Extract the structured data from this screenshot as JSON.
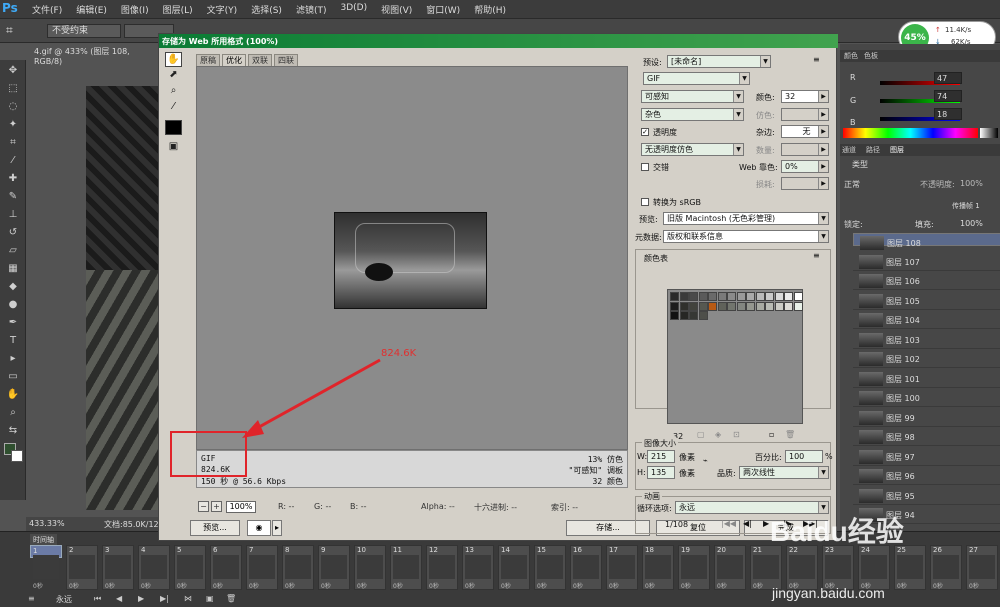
{
  "app": {
    "logo": "Ps",
    "menus": [
      "文件(F)",
      "编辑(E)",
      "图像(I)",
      "图层(L)",
      "文字(Y)",
      "选择(S)",
      "滤镜(T)",
      "3D(D)",
      "视图(V)",
      "窗口(W)",
      "帮助(H)"
    ],
    "options": {
      "preset": "不受约束"
    }
  },
  "network": {
    "percent": "45%",
    "up": "11.4K/s",
    "down": "62K/s"
  },
  "document": {
    "tab": "4.gif @ 433% (图层 108, RGB/8)",
    "zoom": "433.33%",
    "info": "文档:85.0K/12"
  },
  "timeline": {
    "tab": "时间轴",
    "loop": "永远",
    "frames": [
      "1",
      "2",
      "3",
      "4",
      "5",
      "6",
      "7",
      "8",
      "9",
      "10",
      "11",
      "12",
      "13",
      "14",
      "15",
      "16",
      "17",
      "18",
      "19",
      "20",
      "21",
      "22",
      "23",
      "24",
      "25",
      "26",
      "27"
    ],
    "frame_delay": "0秒"
  },
  "panels": {
    "color_tabs": [
      "颜色",
      "色板"
    ],
    "rgb": [
      {
        "ch": "R",
        "val": "47"
      },
      {
        "ch": "G",
        "val": "74"
      },
      {
        "ch": "B",
        "val": "18"
      }
    ],
    "layer_tabs": [
      "通道",
      "路径",
      "图层"
    ],
    "layer_filter": "类型",
    "blend_mode": "正常",
    "opacity_label": "不透明度:",
    "opacity": "100%",
    "lock_label": "锁定:",
    "fill_label": "填充:",
    "fill": "100%",
    "propagate": "传播帧 1",
    "layers": [
      "图层 108",
      "图层 107",
      "图层 106",
      "图层 105",
      "图层 104",
      "图层 103",
      "图层 102",
      "图层 101",
      "图层 100",
      "图层 99",
      "图层 98",
      "图层 97",
      "图层 96",
      "图层 95",
      "图层 94"
    ]
  },
  "dialog": {
    "title": "存储为 Web 所用格式 (100%)",
    "view_tabs": [
      "原稿",
      "优化",
      "双联",
      "四联"
    ],
    "info": {
      "format": "GIF",
      "size": "824.6K",
      "time": "150 秒 @ 56.6 Kbps",
      "dither": "13% 仿色",
      "palette": "\"可感知\" 调板",
      "colors": "32 颜色"
    },
    "annotation": "824.6K",
    "zoom": "100%",
    "readouts": {
      "r": "R: --",
      "g": "G: --",
      "b": "B: --",
      "alpha": "Alpha: --",
      "hex": "十六进制: --",
      "index": "索引: --"
    },
    "buttons": {
      "preview": "预览...",
      "save": "存储...",
      "reset": "复位",
      "done": "完成"
    },
    "settings": {
      "preset_label": "预设:",
      "preset": "[未命名]",
      "format": "GIF",
      "reduction": "可感知",
      "colors_label": "颜色:",
      "colors": "32",
      "dither_algo": "杂色",
      "dither_label": "仿色:",
      "transparency": "透明度",
      "matte_label": "杂边:",
      "matte": "无",
      "trans_dither": "无透明度仿色",
      "amount_label": "数量:",
      "interlaced": "交错",
      "websnap_label": "Web 靠色:",
      "websnap": "0%",
      "lossy_label": "损耗:",
      "srgb": "转换为 sRGB",
      "preview_label": "预览:",
      "preview_val": "旧版 Macintosh (无色彩管理)",
      "metadata_label": "元数据:",
      "metadata": "版权和联系信息",
      "colortable_label": "颜色表",
      "colortable_count": "32",
      "imagesize_label": "图像大小",
      "w_label": "W:",
      "w": "215",
      "h_label": "H:",
      "h": "135",
      "px": "像素",
      "percent_label": "百分比:",
      "percent": "100",
      "pct": "%",
      "quality_label": "品质:",
      "quality": "两次线性",
      "animation_label": "动画",
      "loop_label": "循环选项:",
      "loop": "永远",
      "frame_counter": "1/108"
    },
    "palette_colors": [
      "#2a2a2a",
      "#3a3a3a",
      "#4a4a4a",
      "#5a5a5a",
      "#6a6a6a",
      "#7a7a7a",
      "#8a8a8a",
      "#9a9a9a",
      "#aaaaaa",
      "#bababa",
      "#cacaca",
      "#dadada",
      "#eaeaea",
      "#ffffff",
      "#1c1c1c",
      "#30302c",
      "#42433c",
      "#565850",
      "#b85a14",
      "#60625a",
      "#72756d",
      "#838680",
      "#95978f",
      "#a8aaa2",
      "#b9bbb4",
      "#ccccc6",
      "#dddcd7",
      "#e8f0e8",
      "#121212",
      "#262624",
      "#363734",
      "#4e4f4a"
    ]
  },
  "watermark": {
    "brand": "Baidu经验",
    "url": "jingyan.baidu.com"
  }
}
